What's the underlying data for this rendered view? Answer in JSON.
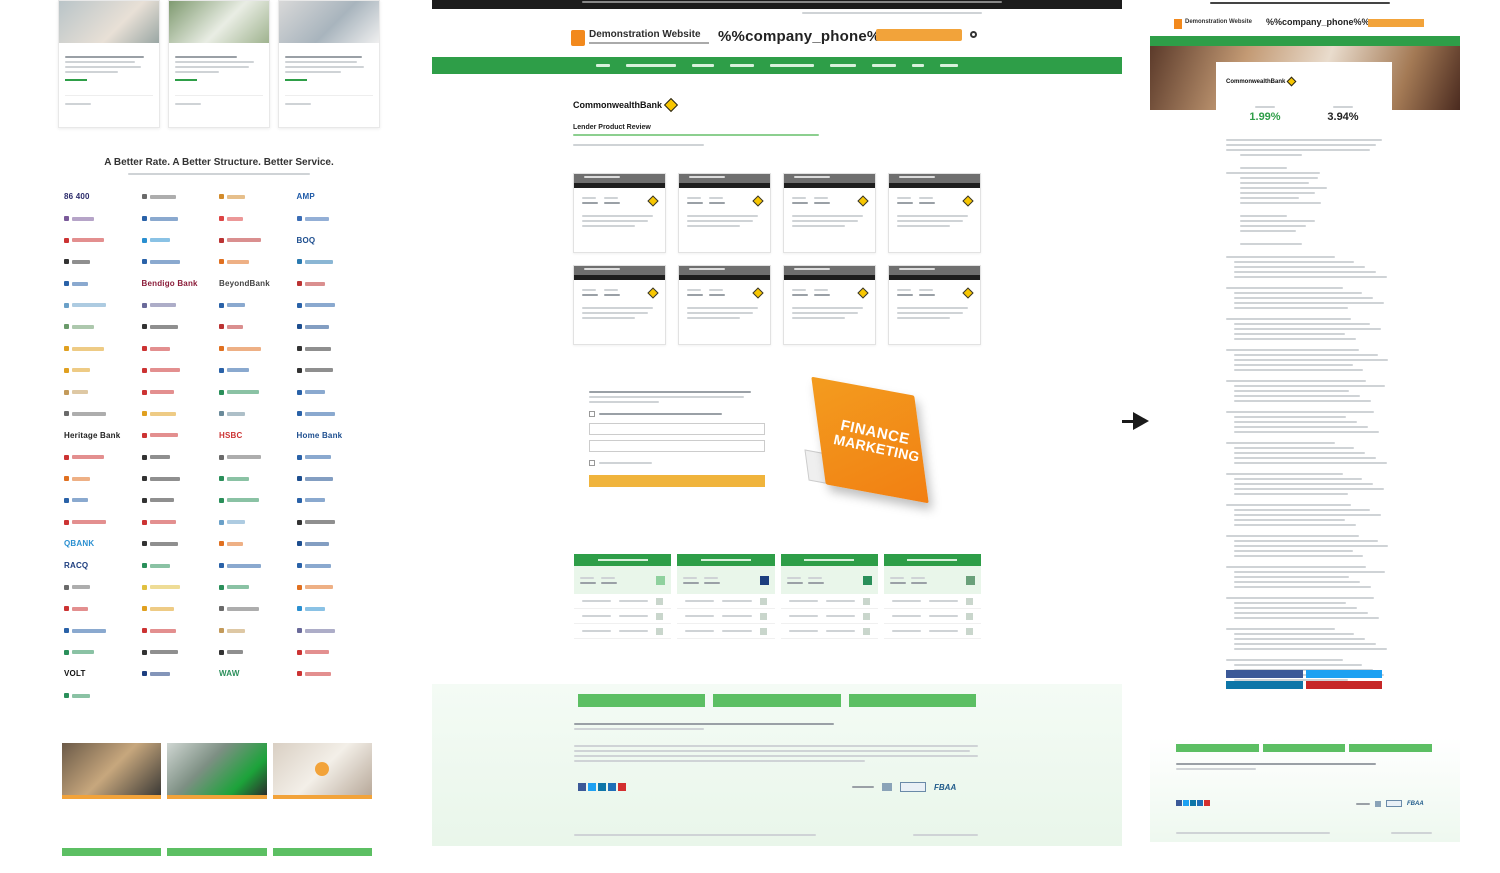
{
  "left_panel": {
    "brands_title": "A Better Rate. A Better Structure. Better Service.",
    "brand_logos": [
      {
        "text": "86 400",
        "color": "#2b2b6b"
      },
      {
        "text": "",
        "color": "#6a6a6a"
      },
      {
        "text": "",
        "color": "#d28b2b"
      },
      {
        "text": "AMP",
        "color": "#1e5aa8"
      },
      {
        "text": "",
        "color": "#7a5a9a"
      },
      {
        "text": "",
        "color": "#2a62a8"
      },
      {
        "text": "",
        "color": "#d44"
      },
      {
        "text": "",
        "color": "#3b6db5"
      },
      {
        "text": "",
        "color": "#c33"
      },
      {
        "text": "",
        "color": "#2a8fd0"
      },
      {
        "text": "",
        "color": "#b33"
      },
      {
        "text": "BOQ",
        "color": "#1d4e8f"
      },
      {
        "text": "",
        "color": "#333"
      },
      {
        "text": "",
        "color": "#2a62a8"
      },
      {
        "text": "",
        "color": "#e07020"
      },
      {
        "text": "",
        "color": "#2a7ab0"
      },
      {
        "text": "",
        "color": "#2a62a8"
      },
      {
        "text": "Bendigo Bank",
        "color": "#8b1d3a"
      },
      {
        "text": "BeyondBank",
        "color": "#444"
      },
      {
        "text": "",
        "color": "#b33"
      },
      {
        "text": "",
        "color": "#6aa0c8"
      },
      {
        "text": "",
        "color": "#6a6a9a"
      },
      {
        "text": "",
        "color": "#2a62a8"
      },
      {
        "text": "",
        "color": "#2a62a8"
      },
      {
        "text": "",
        "color": "#6a9a6a"
      },
      {
        "text": "",
        "color": "#333"
      },
      {
        "text": "",
        "color": "#b33"
      },
      {
        "text": "",
        "color": "#1d4e8f"
      },
      {
        "text": "",
        "color": "#e0a020"
      },
      {
        "text": "",
        "color": "#c33"
      },
      {
        "text": "",
        "color": "#e07020"
      },
      {
        "text": "",
        "color": "#333"
      },
      {
        "text": "",
        "color": "#e0a020"
      },
      {
        "text": "",
        "color": "#c33"
      },
      {
        "text": "",
        "color": "#2a62a8"
      },
      {
        "text": "",
        "color": "#333"
      },
      {
        "text": "",
        "color": "#c39a5a"
      },
      {
        "text": "",
        "color": "#c33"
      },
      {
        "text": "",
        "color": "#2a8f5a"
      },
      {
        "text": "",
        "color": "#2a62a8"
      },
      {
        "text": "",
        "color": "#6a6a6a"
      },
      {
        "text": "",
        "color": "#e0a020"
      },
      {
        "text": "",
        "color": "#6a8a9a"
      },
      {
        "text": "",
        "color": "#2a62a8"
      },
      {
        "text": "Heritage Bank",
        "color": "#222"
      },
      {
        "text": "",
        "color": "#c33"
      },
      {
        "text": "HSBC",
        "color": "#c33"
      },
      {
        "text": "Home Bank",
        "color": "#1d4e8f"
      },
      {
        "text": "",
        "color": "#c33"
      },
      {
        "text": "",
        "color": "#333"
      },
      {
        "text": "",
        "color": "#6a6a6a"
      },
      {
        "text": "",
        "color": "#2a62a8"
      },
      {
        "text": "",
        "color": "#e07020"
      },
      {
        "text": "",
        "color": "#333"
      },
      {
        "text": "",
        "color": "#2a8f5a"
      },
      {
        "text": "",
        "color": "#1d4e8f"
      },
      {
        "text": "",
        "color": "#2a62a8"
      },
      {
        "text": "",
        "color": "#333"
      },
      {
        "text": "",
        "color": "#2a8f5a"
      },
      {
        "text": "",
        "color": "#2a62a8"
      },
      {
        "text": "",
        "color": "#c33"
      },
      {
        "text": "",
        "color": "#c33"
      },
      {
        "text": "",
        "color": "#6aa0c8"
      },
      {
        "text": "",
        "color": "#333"
      },
      {
        "text": "QBANK",
        "color": "#2a8fd0"
      },
      {
        "text": "",
        "color": "#333"
      },
      {
        "text": "",
        "color": "#e07020"
      },
      {
        "text": "",
        "color": "#1d4e8f"
      },
      {
        "text": "RACQ",
        "color": "#1d3e7f"
      },
      {
        "text": "",
        "color": "#2a8f5a"
      },
      {
        "text": "",
        "color": "#2a62a8"
      },
      {
        "text": "",
        "color": "#2a62a8"
      },
      {
        "text": "",
        "color": "#6a6a6a"
      },
      {
        "text": "",
        "color": "#e0c040"
      },
      {
        "text": "",
        "color": "#2a8f5a"
      },
      {
        "text": "",
        "color": "#e07020"
      },
      {
        "text": "",
        "color": "#c33"
      },
      {
        "text": "",
        "color": "#e0a020"
      },
      {
        "text": "",
        "color": "#6a6a6a"
      },
      {
        "text": "",
        "color": "#2a8fd0"
      },
      {
        "text": "",
        "color": "#2a62a8"
      },
      {
        "text": "",
        "color": "#c33"
      },
      {
        "text": "",
        "color": "#c39a5a"
      },
      {
        "text": "",
        "color": "#6a6a9a"
      },
      {
        "text": "",
        "color": "#2a8f5a"
      },
      {
        "text": "",
        "color": "#333"
      },
      {
        "text": "",
        "color": "#333"
      },
      {
        "text": "",
        "color": "#c33"
      },
      {
        "text": "VOLT",
        "color": "#111"
      },
      {
        "text": "",
        "color": "#1d3e7f"
      },
      {
        "text": "WAW",
        "color": "#2a8f5a"
      },
      {
        "text": "",
        "color": "#c33"
      },
      {
        "text": "",
        "color": "#2a8f5a"
      }
    ]
  },
  "middle_panel": {
    "site_name": "Demonstration Website",
    "phone": "%%company_phone%%",
    "bank_name": "CommonwealthBank",
    "section_title": "Lender Product Review",
    "book_title_1": "FINANCE",
    "book_title_2": "MARKETING",
    "association_badge": "FBAA"
  },
  "right_panel": {
    "site_name": "Demonstration Website",
    "phone": "%%company_phone%%",
    "bank_name": "CommonwealthBank",
    "rate_1": "1.99%",
    "rate_2": "3.94%",
    "association_badge": "FBAA"
  },
  "colors": {
    "brand_green": "#2e9e48",
    "accent_orange": "#f2a33a",
    "cba_yellow": "#f7c600"
  }
}
